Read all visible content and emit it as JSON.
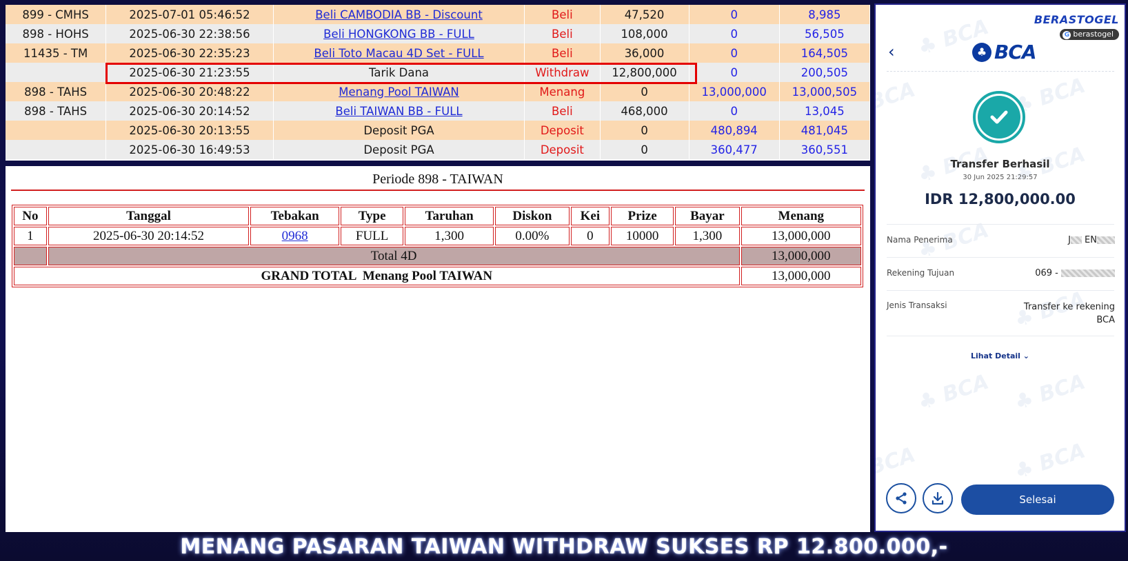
{
  "transactions": [
    {
      "kode": "899 - CMHS",
      "tanggal": "2025-07-01 05:46:52",
      "keterangan": "Beli CAMBODIA BB - Discount",
      "link": true,
      "type": "Beli",
      "debit": "47,520",
      "kredit": "0",
      "saldo": "8,985"
    },
    {
      "kode": "898 - HOHS",
      "tanggal": "2025-06-30 22:38:56",
      "keterangan": "Beli HONGKONG BB - FULL",
      "link": true,
      "type": "Beli",
      "debit": "108,000",
      "kredit": "0",
      "saldo": "56,505"
    },
    {
      "kode": "11435 - TM",
      "tanggal": "2025-06-30 22:35:23",
      "keterangan": "Beli Toto Macau 4D Set - FULL",
      "link": true,
      "type": "Beli",
      "debit": "36,000",
      "kredit": "0",
      "saldo": "164,505"
    },
    {
      "kode": "",
      "tanggal": "2025-06-30 21:23:55",
      "keterangan": "Tarik Dana",
      "link": false,
      "type": "Withdraw",
      "debit": "12,800,000",
      "kredit": "0",
      "saldo": "200,505"
    },
    {
      "kode": "898 - TAHS",
      "tanggal": "2025-06-30 20:48:22",
      "keterangan": "Menang Pool TAIWAN",
      "link": true,
      "type": "Menang",
      "debit": "0",
      "kredit": "13,000,000",
      "saldo": "13,000,505"
    },
    {
      "kode": "898 - TAHS",
      "tanggal": "2025-06-30 20:14:52",
      "keterangan": "Beli TAIWAN BB - FULL",
      "link": true,
      "type": "Beli",
      "debit": "468,000",
      "kredit": "0",
      "saldo": "13,045"
    },
    {
      "kode": "",
      "tanggal": "2025-06-30 20:13:55",
      "keterangan": "Deposit PGA",
      "link": false,
      "type": "Deposit",
      "debit": "0",
      "kredit": "480,894",
      "saldo": "481,045"
    },
    {
      "kode": "",
      "tanggal": "2025-06-30 16:49:53",
      "keterangan": "Deposit PGA",
      "link": false,
      "type": "Deposit",
      "debit": "0",
      "kredit": "360,477",
      "saldo": "360,551"
    }
  ],
  "result": {
    "title": "Periode 898 - TAIWAN",
    "headers": [
      "No",
      "Tanggal",
      "Tebakan",
      "Type",
      "Taruhan",
      "Diskon",
      "Kei",
      "Prize",
      "Bayar",
      "Menang"
    ],
    "rows": [
      {
        "no": "1",
        "tanggal": "2025-06-30 20:14:52",
        "tebakan": "0968",
        "type": "FULL",
        "taruhan": "1,300",
        "diskon": "0.00%",
        "kei": "0",
        "prize": "10000",
        "bayar": "1,300",
        "menang": "13,000,000"
      }
    ],
    "total_label": "Total 4D",
    "total_value": "13,000,000",
    "grand_label": "GRAND TOTAL  Menang Pool TAIWAN",
    "grand_value": "13,000,000"
  },
  "receipt": {
    "brand_watermark": "BERASTOGEL",
    "brand_tag": "berastogel",
    "bank_logo": "BCA",
    "status": "Transfer Berhasil",
    "datetime": "30 Jun 2025 21:29:57",
    "amount": "IDR 12,800,000.00",
    "fields": [
      {
        "label": "Nama Penerima",
        "value_prefix": "J",
        "value_mid": " EN",
        "masked": true
      },
      {
        "label": "Rekening Tujuan",
        "value_prefix": "069 - ",
        "value_mid": "",
        "masked": true
      },
      {
        "label": "Jenis Transaksi",
        "value_prefix": "Transfer ke rekening",
        "value_mid": "BCA",
        "masked": false
      }
    ],
    "detail_link": "Lihat Detail",
    "done_button": "Selesai",
    "icons": {
      "back": "chevron-left-icon",
      "share": "share-icon",
      "download": "download-icon",
      "success": "check-icon"
    }
  },
  "banner": "MENANG PASARAN TAIWAN WITHDRAW SUKSES RP 12.800.000,-",
  "colors": {
    "accent_red": "#e11919",
    "link_blue": "#1f2bd6",
    "bca_blue": "#0b3aa0",
    "success_teal": "#1aa8a8",
    "row_peach": "#fbd9b2"
  }
}
